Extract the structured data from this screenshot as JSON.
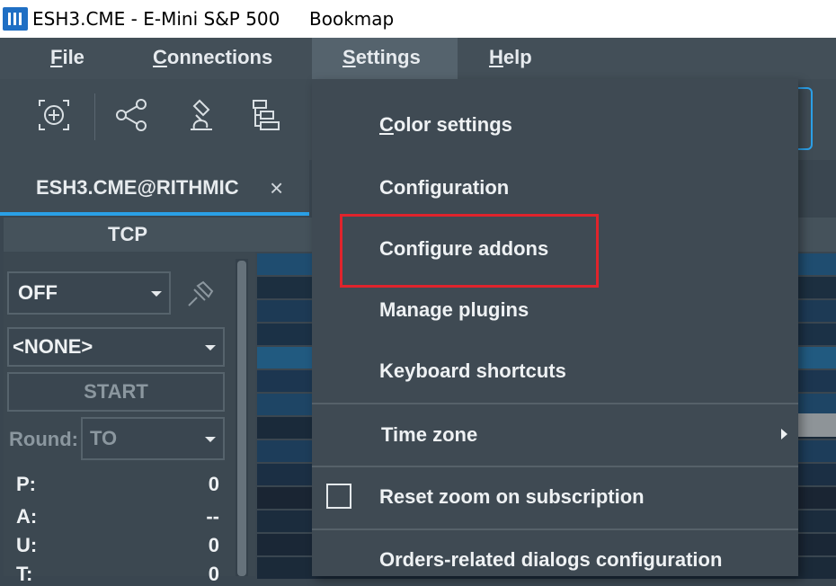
{
  "titlebar": {
    "symbol": "ESH3.CME - E-Mini S&P 500",
    "app_name": "Bookmap",
    "icon": "bookmap-app-icon"
  },
  "menubar": {
    "file": {
      "hotkey": "F",
      "rest": "ile"
    },
    "connections": {
      "hotkey": "C",
      "rest": "onnections"
    },
    "settings": {
      "hotkey": "S",
      "rest": "ettings"
    },
    "help": {
      "hotkey": "H",
      "rest": "elp"
    }
  },
  "toolbar": {
    "icons": [
      "add-instrument-icon",
      "share-icon",
      "analysis-icon",
      "layout-icon"
    ]
  },
  "tab": {
    "label": "ESH3.CME@RITHMIC",
    "close": "×"
  },
  "panel": {
    "title": "TCP",
    "mode_select": "OFF",
    "strategy_select": "<NONE>",
    "start_label": "START",
    "round_label": "Round:",
    "round_select": "TO",
    "stats": [
      {
        "label": "P:",
        "value": "0"
      },
      {
        "label": "A:",
        "value": "--"
      },
      {
        "label": "U:",
        "value": "0"
      },
      {
        "label": "T:",
        "value": "0"
      }
    ]
  },
  "settings_menu": {
    "color_settings": {
      "hotkey": "C",
      "rest": "olor settings"
    },
    "configuration": "Configuration",
    "configure_addons": "Configure addons",
    "manage_plugins": "Manage plugins",
    "keyboard_shortcuts": "Keyboard shortcuts",
    "time_zone": "Time zone",
    "reset_zoom": "Reset zoom on subscription",
    "orders_dialogs": "Orders-related dialogs configuration"
  },
  "colors": {
    "accent_blue": "#2aa0e6",
    "highlight_red": "#e0242c",
    "menu_bg": "#3f4a53"
  }
}
